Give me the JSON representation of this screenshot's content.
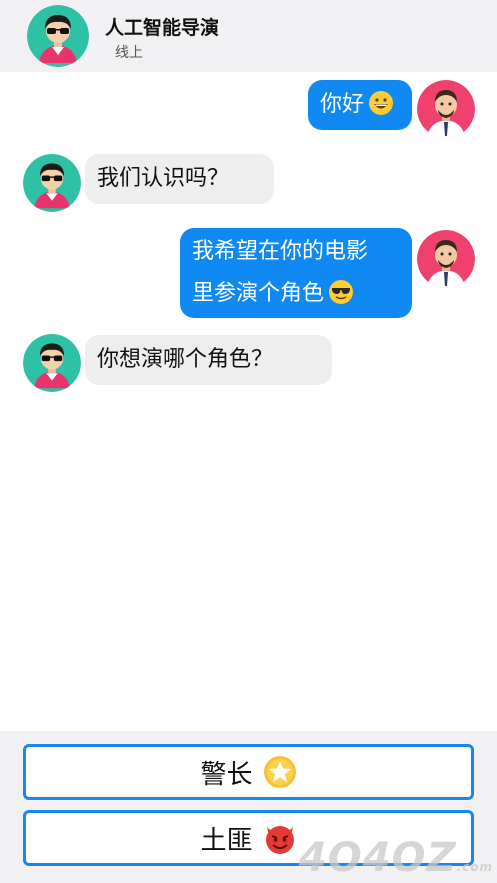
{
  "header": {
    "title": "人工智能导演",
    "status": "线上"
  },
  "messages": [
    {
      "from": "user",
      "text": "你好",
      "emoji": "grinning-face-icon"
    },
    {
      "from": "bot",
      "text": "我们认识吗？"
    },
    {
      "from": "user",
      "line1": "我希望在你的电影",
      "line2": "里参演个角色",
      "emoji": "sunglasses-face-icon"
    },
    {
      "from": "bot",
      "text": "你想演哪个角色？"
    }
  ],
  "choices": [
    {
      "label": "警长",
      "icon": "star-icon"
    },
    {
      "label": "土匪",
      "icon": "devil-face-icon"
    }
  ],
  "watermark": {
    "text": "4O4OZ",
    "suffix": ".com"
  },
  "colors": {
    "accent": "#1189f2",
    "header_bg": "#f1f1f3",
    "bot_bubble": "#eeeeef"
  }
}
